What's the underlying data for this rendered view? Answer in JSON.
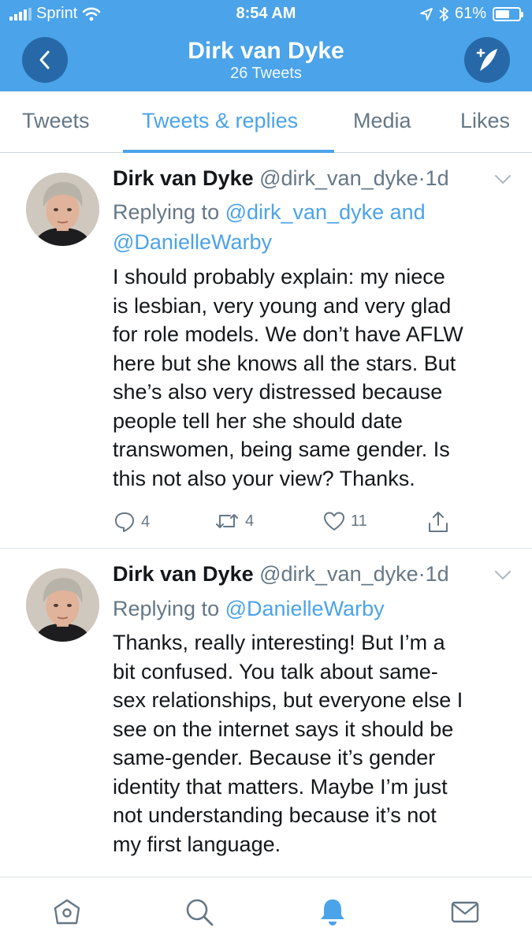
{
  "status_bar": {
    "carrier": "Sprint",
    "time": "8:54 AM",
    "battery_percent": "61%",
    "battery_level": 0.61,
    "icons": [
      "signal-bars-icon",
      "wifi-icon",
      "location-arrow-icon",
      "bluetooth-icon",
      "battery-icon"
    ]
  },
  "header": {
    "title": "Dirk van Dyke",
    "subtitle": "26 Tweets",
    "back_icon": "chevron-left-icon",
    "compose_icon": "compose-tweet-icon",
    "accent_color": "#4ba3e9",
    "button_color": "#2769a8"
  },
  "tabs": [
    {
      "label": "Tweets",
      "active": false
    },
    {
      "label": "Tweets & replies",
      "active": true
    },
    {
      "label": "Media",
      "active": false
    },
    {
      "label": "Likes",
      "active": false
    }
  ],
  "tweets": [
    {
      "name": "Dirk van Dyke",
      "handle": "@dirk_van_dyke",
      "separator": "·",
      "time": "1d",
      "replying_prefix": "Replying to",
      "replying_to_1": "@dirk_van_dyke",
      "replying_and": "and",
      "replying_to_2": "@DanielleWarby",
      "text_lines": [
        "I should probably explain: my niece",
        "is lesbian, very young and very glad",
        "for role models. We don’t have AFLW",
        "here but she knows all the stars. But",
        "she’s also very distressed because",
        "people tell her she should date",
        "transwomen, being same gender. Is",
        "this not also your view? Thanks."
      ],
      "replies": "4",
      "retweets": "4",
      "likes": "11"
    },
    {
      "name": "Dirk van Dyke",
      "handle": "@dirk_van_dyke",
      "separator": "·",
      "time": "1d",
      "replying_prefix": "Replying to",
      "replying_to_1": "@DanielleWarby",
      "text_lines": [
        "Thanks,  really interesting! But I’m a",
        "bit confused. You talk about same-",
        "sex relationships, but everyone else I",
        "see on the internet says it should be",
        "same-gender. Because it’s gender",
        "identity that matters. Maybe I’m just",
        "not understanding because it’s not",
        "my first language."
      ]
    }
  ],
  "bottom_nav": [
    {
      "icon": "home-icon",
      "active": false
    },
    {
      "icon": "search-icon",
      "active": false
    },
    {
      "icon": "notifications-bell-icon",
      "active": true
    },
    {
      "icon": "messages-envelope-icon",
      "active": false
    }
  ]
}
